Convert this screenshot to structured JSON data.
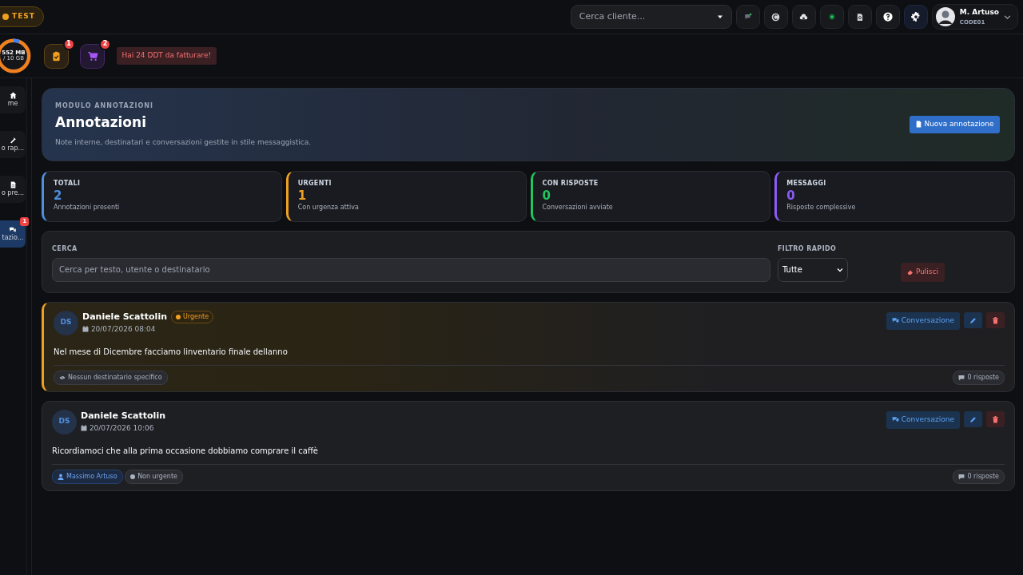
{
  "env_badge": "TEST",
  "client_search": {
    "placeholder": "Cerca cliente..."
  },
  "toolbar_icons": [
    {
      "kind": "chat",
      "selected": false
    },
    {
      "kind": "euro",
      "selected": false
    },
    {
      "kind": "cloud",
      "selected": false
    },
    {
      "kind": "dot",
      "selected": false
    },
    {
      "kind": "doc",
      "selected": false
    },
    {
      "kind": "help",
      "selected": false
    },
    {
      "kind": "gear",
      "selected": true
    }
  ],
  "user": {
    "name": "M. Artuso",
    "code": "CODE01"
  },
  "storage": {
    "used": "552 MB",
    "total": "/ 10 GB",
    "level": 0.06
  },
  "quick_icons": [
    {
      "kind": "clipboard",
      "badge": "1",
      "color": "#f0a020"
    },
    {
      "kind": "cart",
      "badge": "2",
      "color": "#a855f7"
    }
  ],
  "alert": "Hai 24 DDT da fatturare!",
  "sidebar": {
    "items": [
      {
        "label": "me",
        "kind": "home",
        "selected": false
      },
      {
        "label": "o rap...",
        "kind": "tools",
        "selected": false
      },
      {
        "label": "o pre...",
        "kind": "doc",
        "selected": false
      },
      {
        "label": "tazio...",
        "kind": "chat",
        "selected": true,
        "badge": "1"
      }
    ]
  },
  "header": {
    "eyebrow": "MODULO ANNOTAZIONI",
    "title": "Annotazioni",
    "subtitle": "Note interne, destinatari e conversazioni gestite in stile messaggistica.",
    "button": "Nuova annotazione"
  },
  "stats": [
    {
      "label": "TOTALI",
      "value": "2",
      "caption": "Annotazioni presenti",
      "color": "#4f8fe0"
    },
    {
      "label": "URGENTI",
      "value": "1",
      "caption": "Con urgenza attiva",
      "color": "#f0a020"
    },
    {
      "label": "CON RISPOSTE",
      "value": "0",
      "caption": "Conversazioni avviate",
      "color": "#22c55e"
    },
    {
      "label": "MESSAGGI",
      "value": "0",
      "caption": "Risposte complessive",
      "color": "#8b5cf6"
    }
  ],
  "filters": {
    "search_label": "CERCA",
    "search_placeholder": "Cerca per testo, utente o destinatario",
    "filter_label": "FILTRO RAPIDO",
    "filter_value": "Tutte",
    "clear_button": "Pulisci"
  },
  "notes": [
    {
      "initials": "DS",
      "author": "Daniele Scattolin",
      "urgent": true,
      "urgent_label": "Urgente",
      "date": "20/07/2026 08:04",
      "text": "Nel mese di Dicembre facciamo linventario finale dellanno",
      "tags": [
        {
          "kind": "none",
          "text": "Nessun destinatario specifico"
        }
      ],
      "replies": "0 risposte",
      "conversation_button": "Conversazione"
    },
    {
      "initials": "DS",
      "author": "Daniele Scattolin",
      "urgent": false,
      "date": "20/07/2026 10:06",
      "text": "Ricordiamoci che alla prima occasione dobbiamo comprare il caffè",
      "tags": [
        {
          "kind": "user",
          "text": "Massimo Artuso"
        },
        {
          "kind": "status",
          "text": "Non urgente"
        }
      ],
      "replies": "0 risposte",
      "conversation_button": "Conversazione"
    }
  ]
}
